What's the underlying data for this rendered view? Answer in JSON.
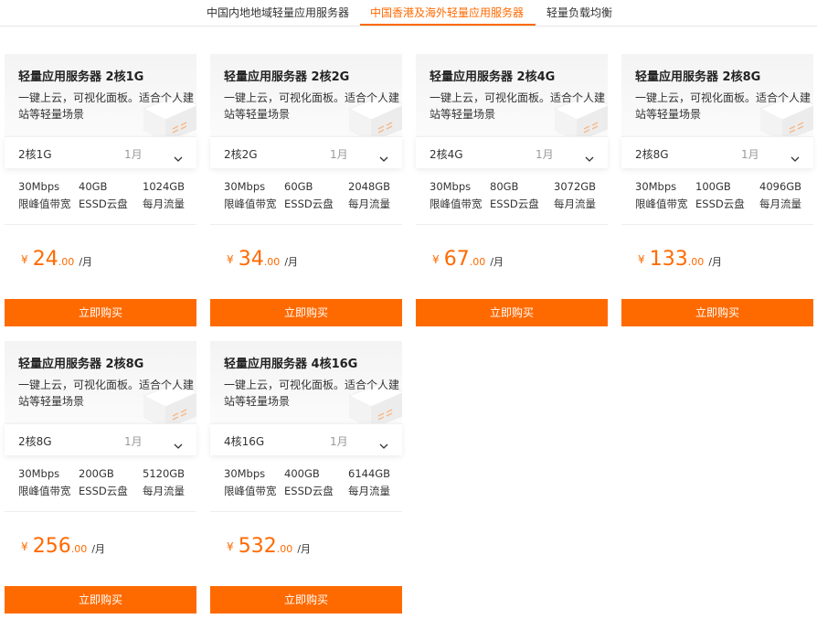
{
  "tabs": [
    {
      "label": "中国内地地域轻量应用服务器",
      "active": false
    },
    {
      "label": "中国香港及海外轻量应用服务器",
      "active": true
    },
    {
      "label": "轻量负载均衡",
      "active": false
    }
  ],
  "colors": {
    "accent": "#ff6a00"
  },
  "cards": [
    {
      "title": "轻量应用服务器 2核1G",
      "desc": "一键上云，可视化面板。适合个人建站等轻量场景",
      "spec": "2核1G",
      "period": "1月",
      "bandwidth": "30Mbps",
      "bandwidth_label": "限峰值带宽",
      "disk": "40GB",
      "disk_label": "ESSD云盘",
      "traffic": "1024GB",
      "traffic_label": "每月流量",
      "currency": "¥",
      "price_int": "24",
      "price_dec": ".00",
      "price_unit": "/月",
      "buy_label": "立即购买"
    },
    {
      "title": "轻量应用服务器 2核2G",
      "desc": "一键上云，可视化面板。适合个人建站等轻量场景",
      "spec": "2核2G",
      "period": "1月",
      "bandwidth": "30Mbps",
      "bandwidth_label": "限峰值带宽",
      "disk": "60GB",
      "disk_label": "ESSD云盘",
      "traffic": "2048GB",
      "traffic_label": "每月流量",
      "currency": "¥",
      "price_int": "34",
      "price_dec": ".00",
      "price_unit": "/月",
      "buy_label": "立即购买"
    },
    {
      "title": "轻量应用服务器 2核4G",
      "desc": "一键上云，可视化面板。适合个人建站等轻量场景",
      "spec": "2核4G",
      "period": "1月",
      "bandwidth": "30Mbps",
      "bandwidth_label": "限峰值带宽",
      "disk": "80GB",
      "disk_label": "ESSD云盘",
      "traffic": "3072GB",
      "traffic_label": "每月流量",
      "currency": "¥",
      "price_int": "67",
      "price_dec": ".00",
      "price_unit": "/月",
      "buy_label": "立即购买"
    },
    {
      "title": "轻量应用服务器 2核8G",
      "desc": "一键上云，可视化面板。适合个人建站等轻量场景",
      "spec": "2核8G",
      "period": "1月",
      "bandwidth": "30Mbps",
      "bandwidth_label": "限峰值带宽",
      "disk": "100GB",
      "disk_label": "ESSD云盘",
      "traffic": "4096GB",
      "traffic_label": "每月流量",
      "currency": "¥",
      "price_int": "133",
      "price_dec": ".00",
      "price_unit": "/月",
      "buy_label": "立即购买"
    },
    {
      "title": "轻量应用服务器 2核8G",
      "desc": "一键上云，可视化面板。适合个人建站等轻量场景",
      "spec": "2核8G",
      "period": "1月",
      "bandwidth": "30Mbps",
      "bandwidth_label": "限峰值带宽",
      "disk": "200GB",
      "disk_label": "ESSD云盘",
      "traffic": "5120GB",
      "traffic_label": "每月流量",
      "currency": "¥",
      "price_int": "256",
      "price_dec": ".00",
      "price_unit": "/月",
      "buy_label": "立即购买"
    },
    {
      "title": "轻量应用服务器 4核16G",
      "desc": "一键上云，可视化面板。适合个人建站等轻量场景",
      "spec": "4核16G",
      "period": "1月",
      "bandwidth": "30Mbps",
      "bandwidth_label": "限峰值带宽",
      "disk": "400GB",
      "disk_label": "ESSD云盘",
      "traffic": "6144GB",
      "traffic_label": "每月流量",
      "currency": "¥",
      "price_int": "532",
      "price_dec": ".00",
      "price_unit": "/月",
      "buy_label": "立即购买"
    }
  ]
}
